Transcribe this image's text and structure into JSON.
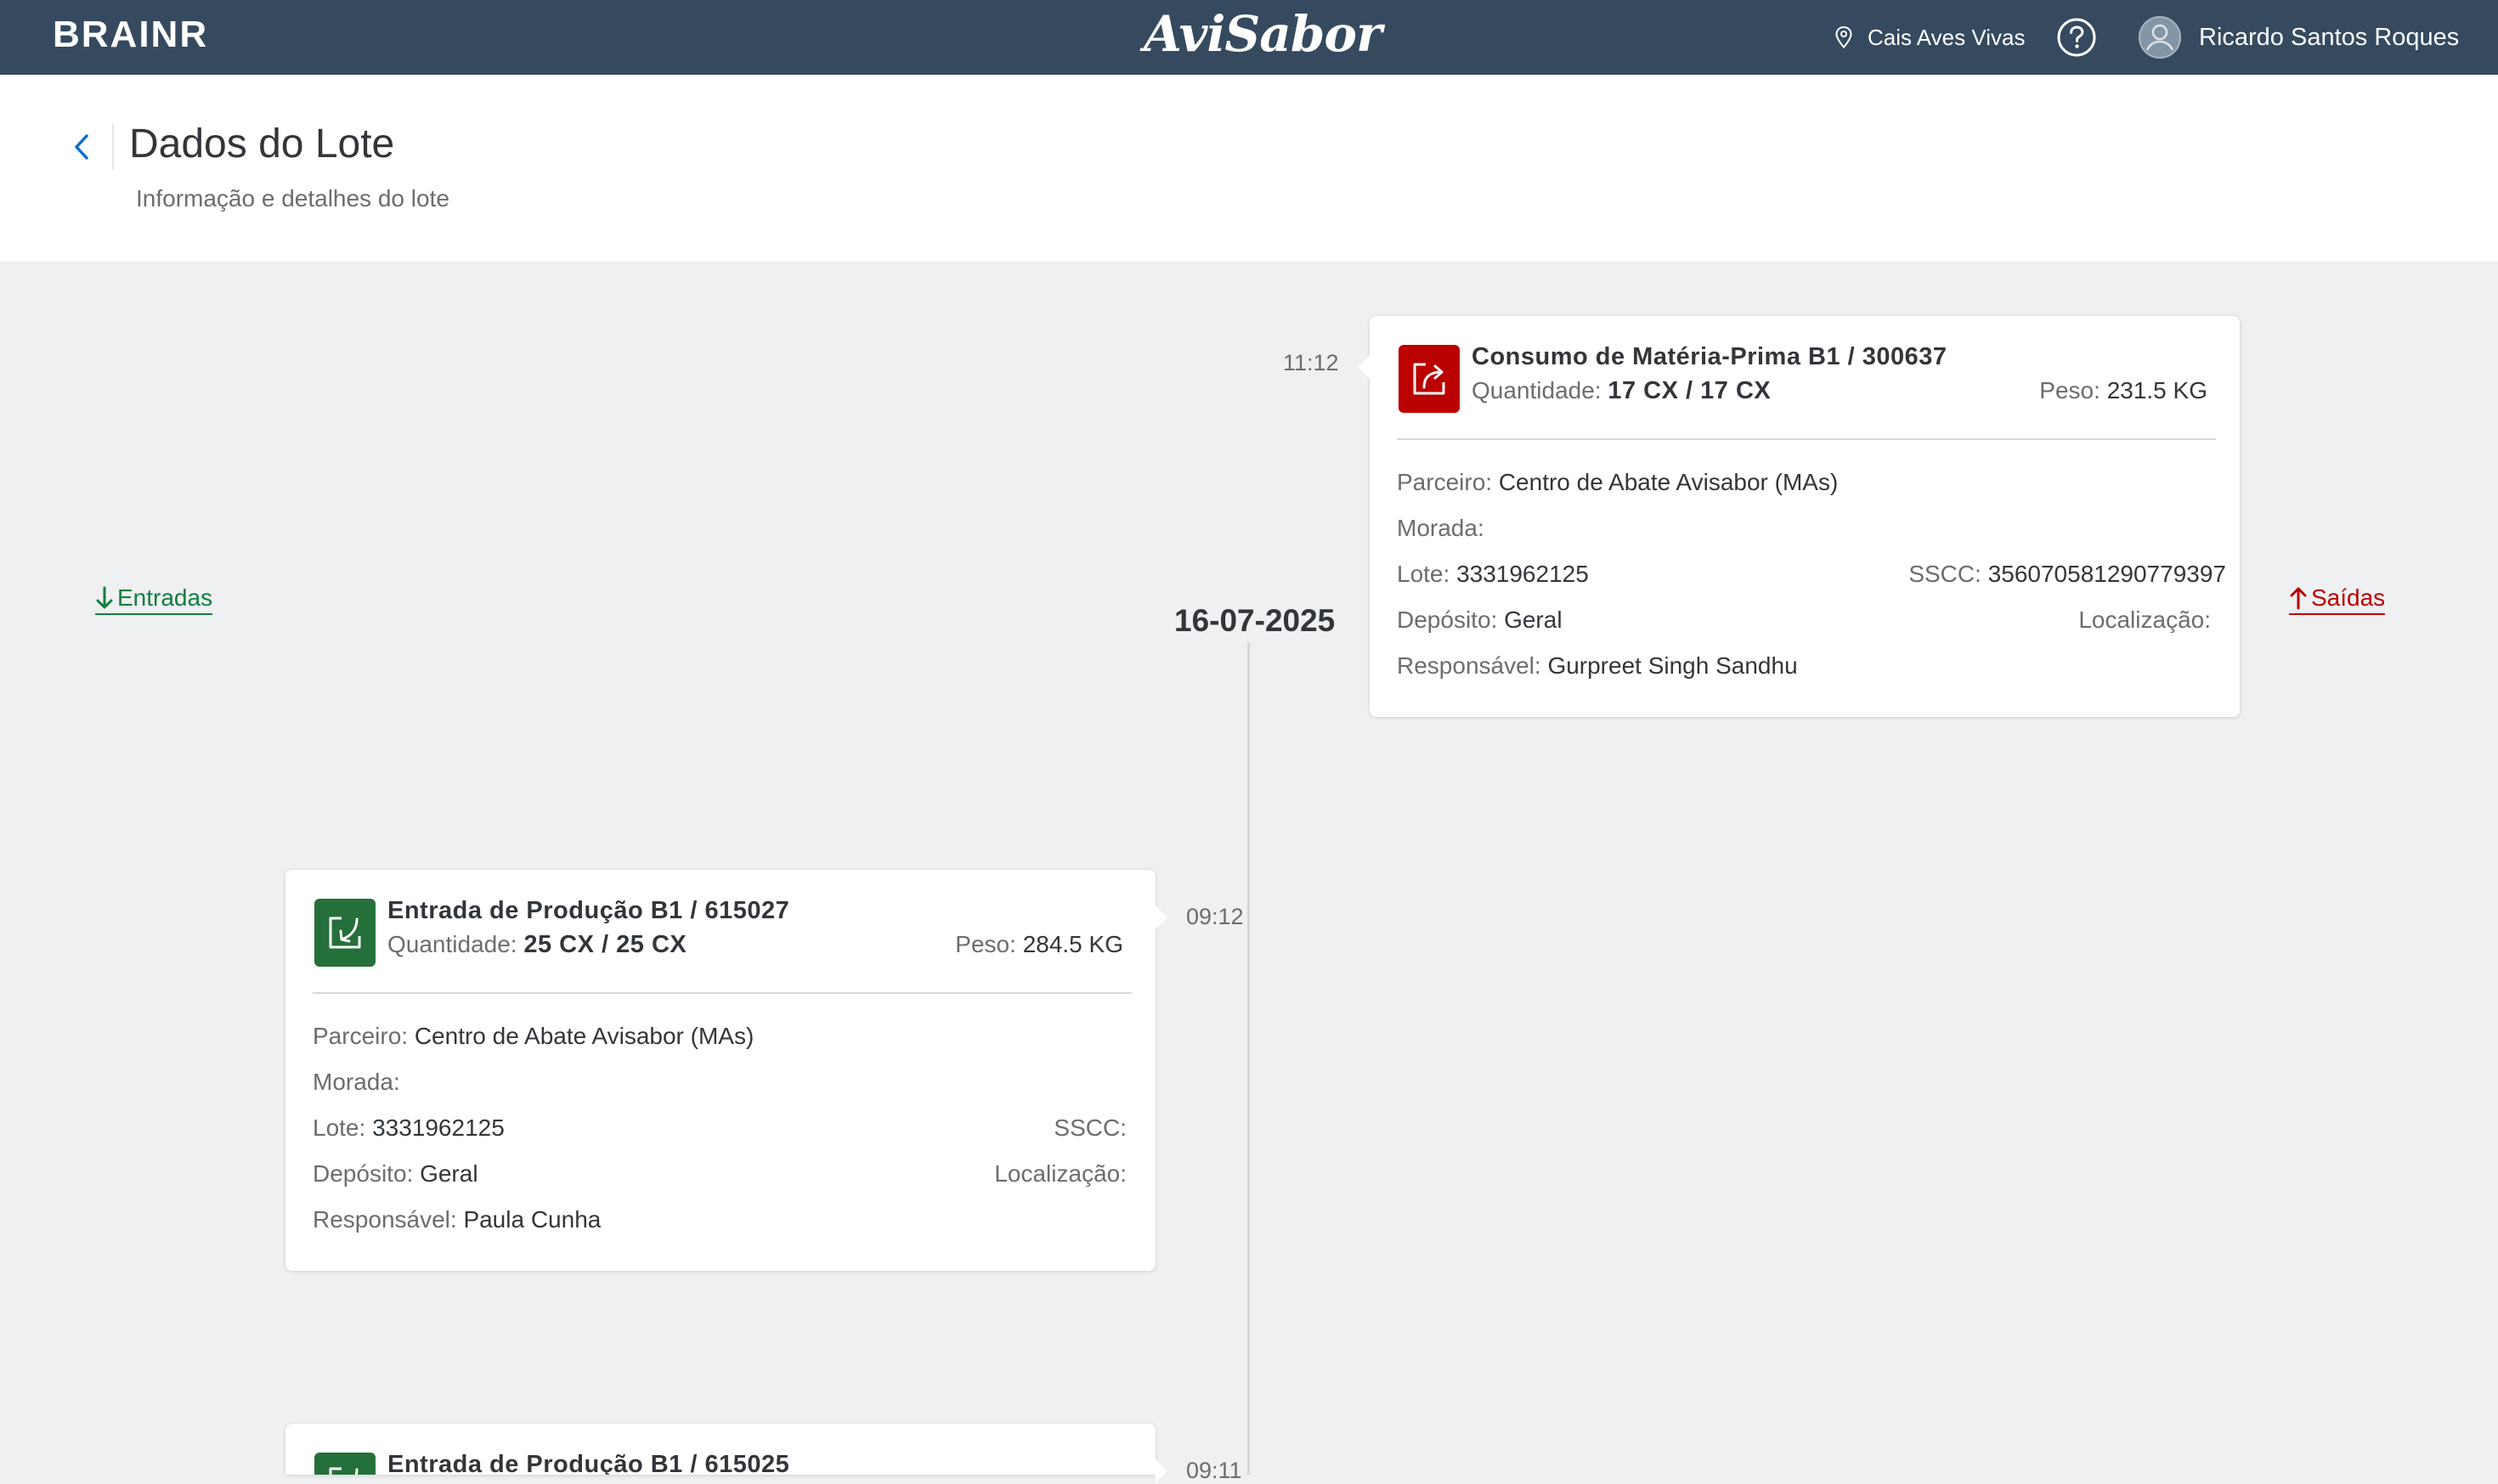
{
  "shell": {
    "brand": "BRAINR",
    "logo": "AviSabor",
    "location": "Cais Aves Vivas",
    "user": "Ricardo Santos Roques",
    "location_icon": "map-pin-icon",
    "help_icon": "help-circle-icon",
    "avatar_icon": "user-avatar-icon"
  },
  "header": {
    "title": "Dados do Lote",
    "subtitle": "Informação e detalhes do lote"
  },
  "links": {
    "in_label": "Entradas",
    "out_label": "Saídas"
  },
  "timeline": {
    "date": "16-07-2025"
  },
  "labels": {
    "quantidade": "Quantidade:",
    "peso": "Peso:",
    "parceiro": "Parceiro:",
    "morada": "Morada:",
    "lote": "Lote:",
    "sscc": "SSCC:",
    "deposito": "Depósito:",
    "localizacao": "Localização:",
    "responsavel": "Responsável:"
  },
  "entries": [
    {
      "time": "11:12",
      "direction": "out",
      "title": "Consumo de Matéria-Prima B1 / 300637",
      "quantidade": "17 CX / 17 CX",
      "peso": "231.5 KG",
      "parceiro": "Centro de Abate Avisabor (MAs)",
      "morada": "",
      "lote": "3331962125",
      "sscc": "356070581290779397",
      "deposito": "Geral",
      "localizacao": "",
      "responsavel": "Gurpreet Singh Sandhu",
      "color": "#bb0000"
    },
    {
      "time": "09:12",
      "direction": "in",
      "title": "Entrada de Produção B1 / 615027",
      "quantidade": "25 CX / 25 CX",
      "peso": "284.5 KG",
      "parceiro": "Centro de Abate Avisabor (MAs)",
      "morada": "",
      "lote": "3331962125",
      "sscc": "",
      "deposito": "Geral",
      "localizacao": "",
      "responsavel": "Paula Cunha",
      "color": "#256f3a"
    },
    {
      "time": "09:11",
      "direction": "in",
      "title": "Entrada de Produção B1 / 615025",
      "color": "#256f3a"
    }
  ]
}
